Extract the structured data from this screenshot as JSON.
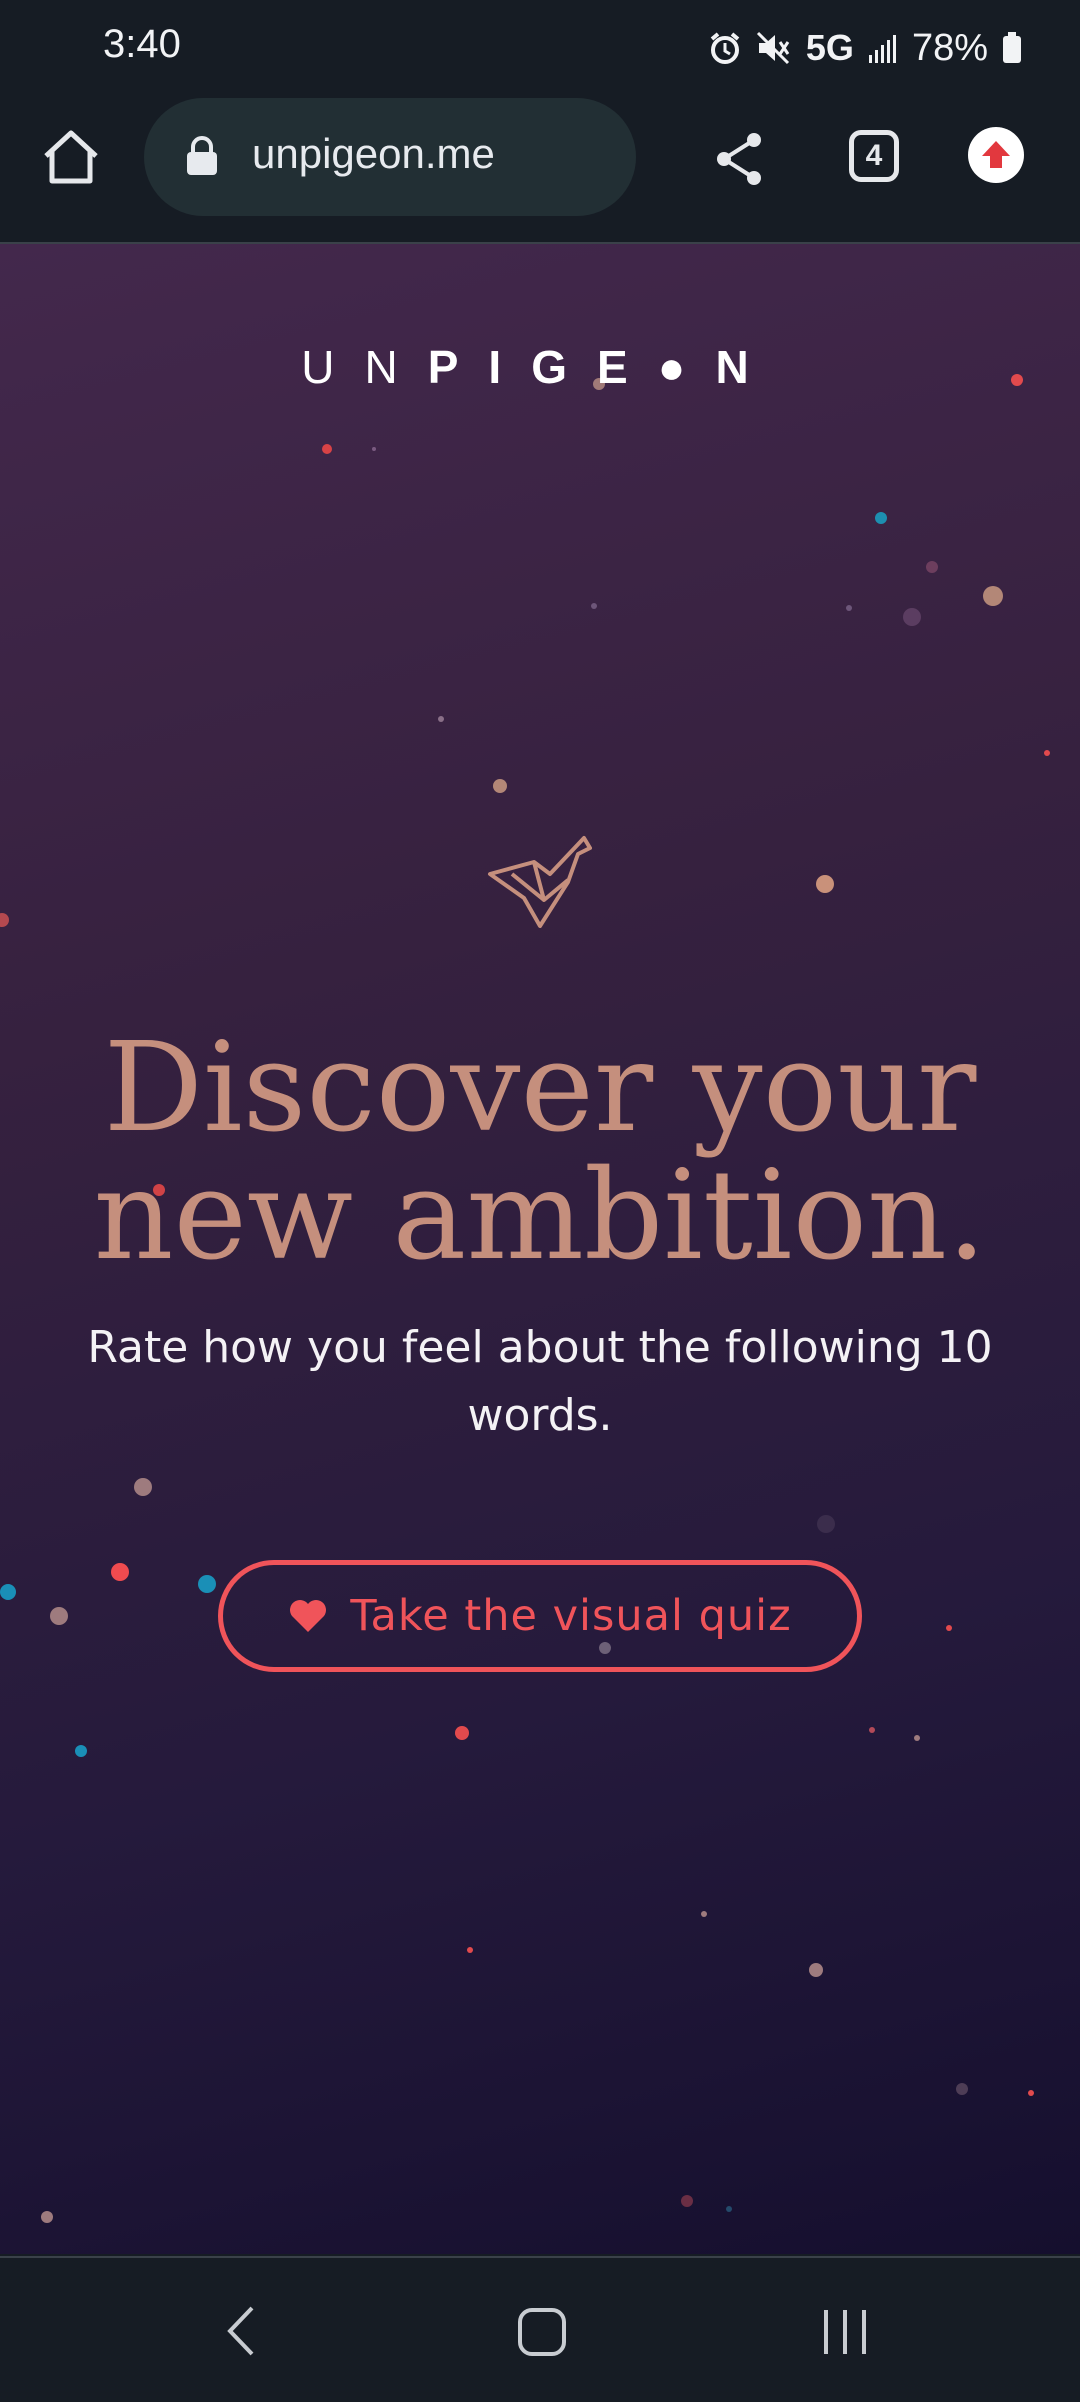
{
  "status_bar": {
    "time": "3:40",
    "network": "5G",
    "battery": "78%",
    "icons": [
      "alarm-icon",
      "mute-icon",
      "signal-icon",
      "battery-icon"
    ]
  },
  "browser": {
    "url": "unpigeon.me",
    "tab_count": "4",
    "icons": [
      "home-icon",
      "lock-icon",
      "share-icon",
      "tabs-icon",
      "update-icon"
    ]
  },
  "page": {
    "logo": {
      "light": "UN",
      "bold": "PIGE",
      "circle": "O",
      "end": "N"
    },
    "headline_line1": "Discover your",
    "headline_line2": "new ambition.",
    "subtext": "Rate how you feel about the following 10 words.",
    "cta_label": "Take the visual quiz",
    "colors": {
      "accent": "#f0545a",
      "headline": "#c58f7d",
      "background_top": "#43284c",
      "background_bottom": "#150f2e"
    }
  },
  "navbar": {
    "icons": [
      "back-icon",
      "home-nav-icon",
      "recents-icon"
    ]
  }
}
